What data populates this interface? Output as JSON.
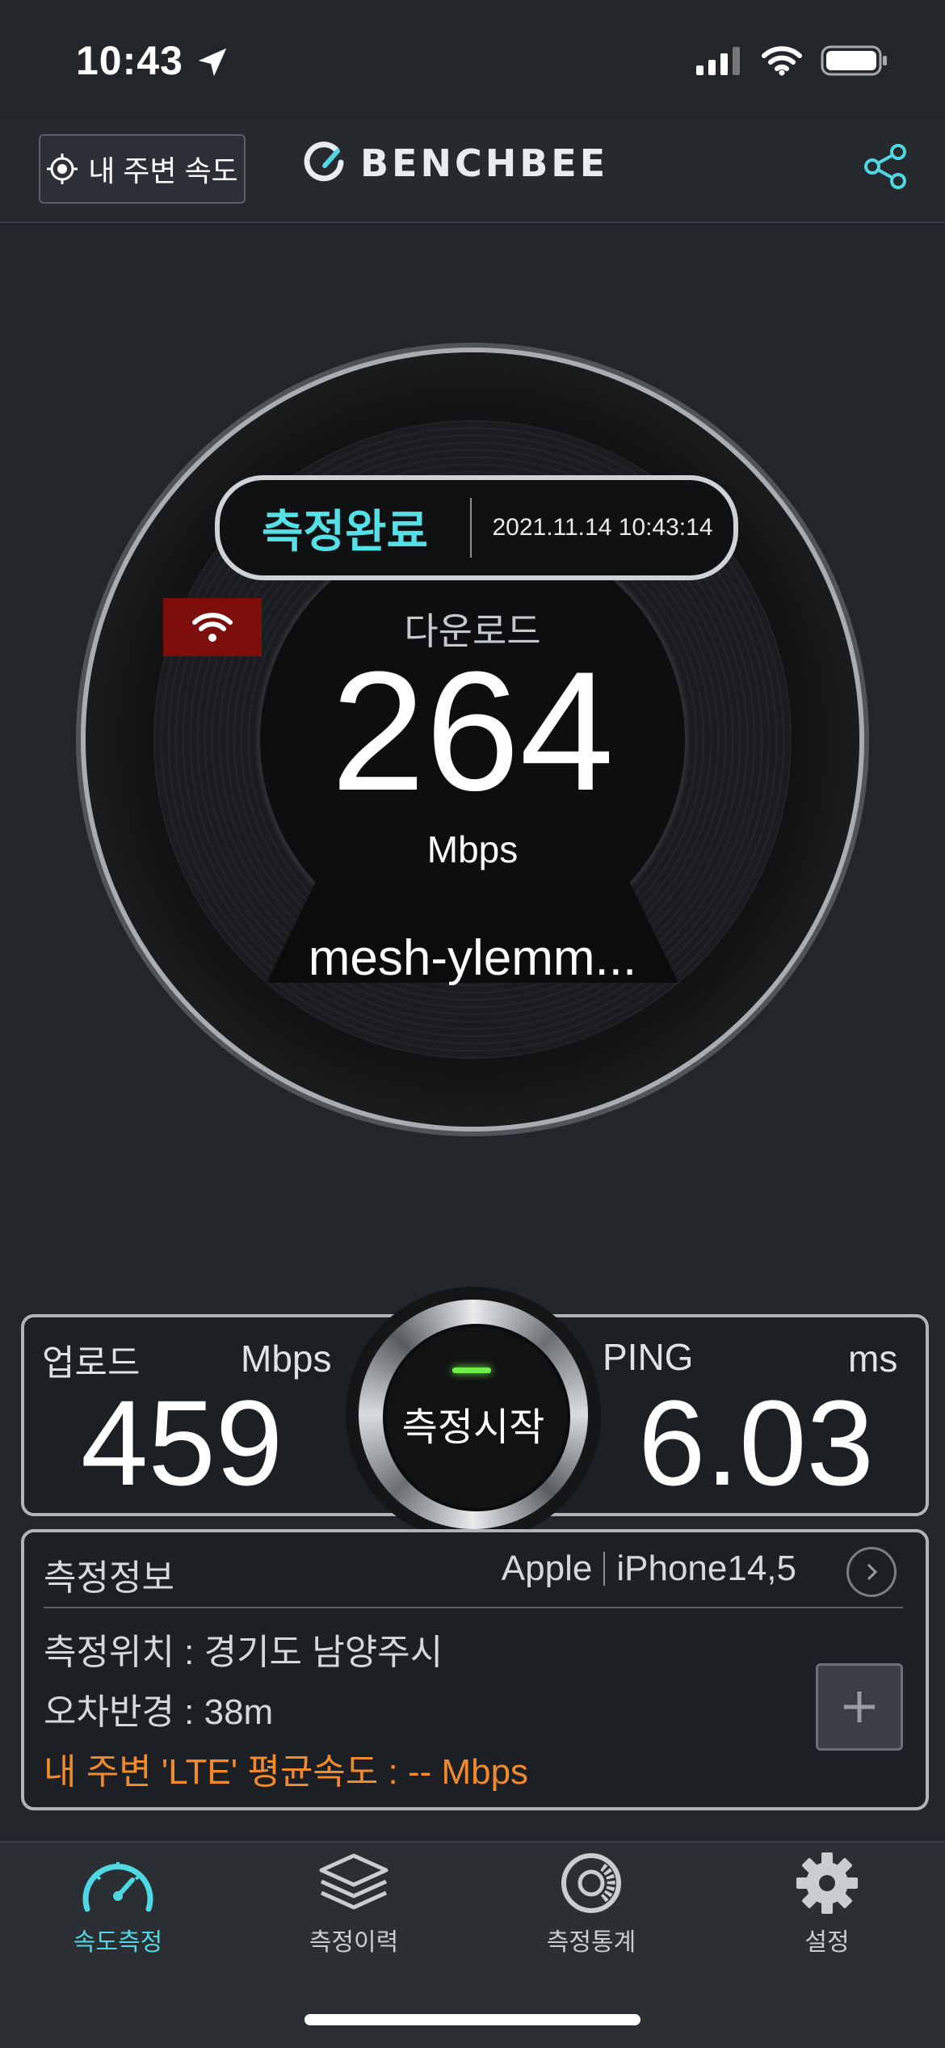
{
  "status_bar": {
    "time": "10:43"
  },
  "header": {
    "nearby_button_label": "내 주변 속도",
    "logo_text": "BENCHBEE"
  },
  "gauge": {
    "status": "측정완료",
    "timestamp": "2021.11.14 10:43:14",
    "download_label": "다운로드",
    "download_value": "264",
    "download_unit": "Mbps",
    "network_name": "mesh-ylemm...",
    "connection_type_icon": "wifi-icon"
  },
  "results": {
    "upload_label": "업로드",
    "upload_unit": "Mbps",
    "upload_value": "459",
    "ping_label": "PING",
    "ping_unit": "ms",
    "ping_value": "6.03",
    "start_button_label": "측정시작"
  },
  "info": {
    "title": "측정정보",
    "device_brand": "Apple",
    "device_model": "iPhone14,5",
    "location": "측정위치 : 경기도 남양주시",
    "error_radius": "오차반경 : 38m",
    "nearby_avg": "내 주변 'LTE' 평균속도 : -- Mbps"
  },
  "tabs": [
    {
      "label": "속도측정",
      "icon": "speedometer-icon",
      "active": true
    },
    {
      "label": "측정이력",
      "icon": "layers-icon",
      "active": false
    },
    {
      "label": "측정통계",
      "icon": "statistics-icon",
      "active": false
    },
    {
      "label": "설정",
      "icon": "gear-icon",
      "active": false
    }
  ],
  "colors": {
    "accent": "#4fd8e3",
    "background": "#22262b",
    "warning": "#f08a2c",
    "wifi_badge": "#7d0e0b",
    "led": "#6ef04a"
  }
}
